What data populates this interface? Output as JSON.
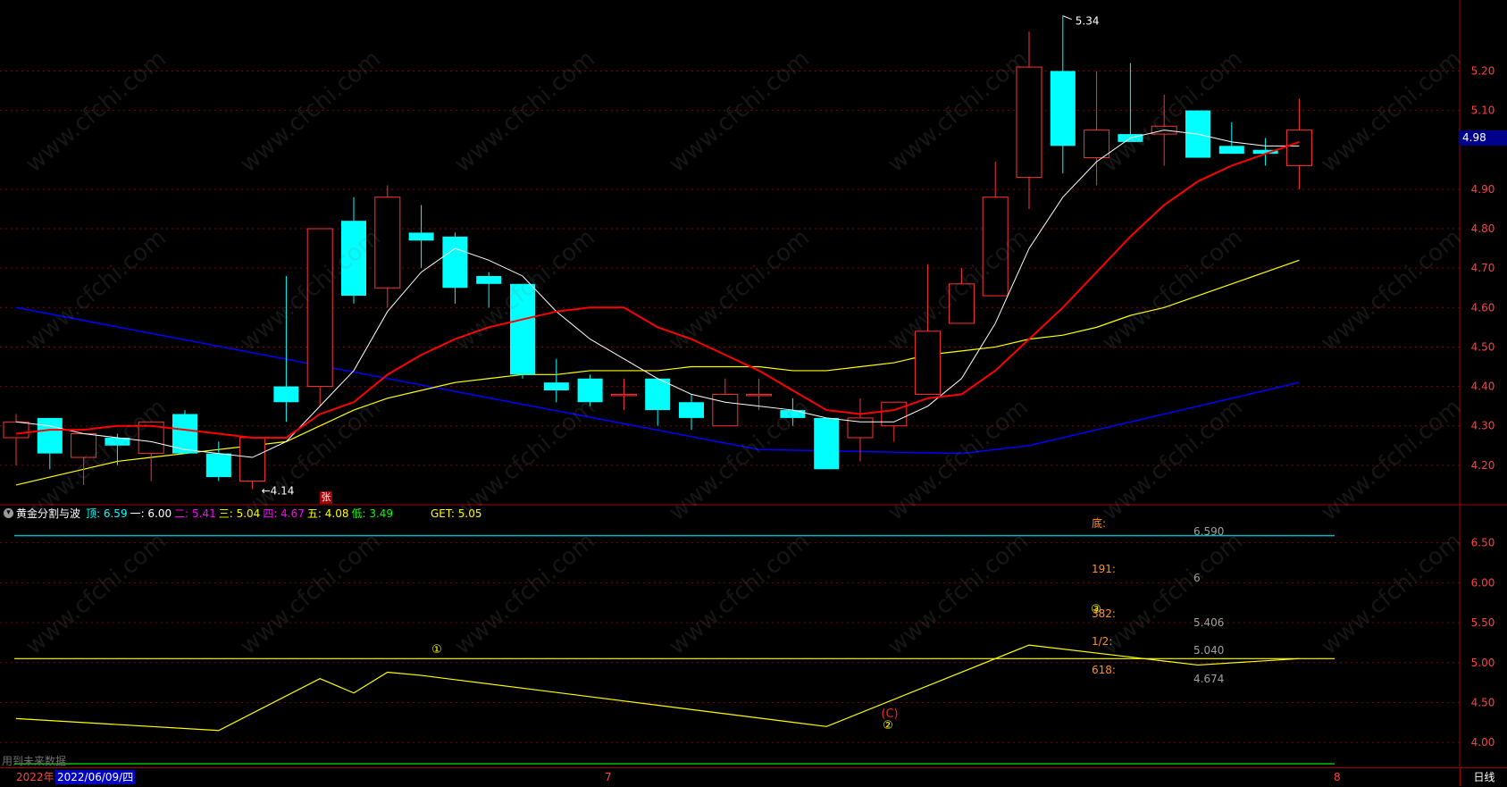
{
  "colors": {
    "up": "#ff3232",
    "down": "#00ffff",
    "ma_white": "#ffffff",
    "ma_red": "#ff0000",
    "ma_yellow": "#ffff00",
    "ma_blue": "#0000ff",
    "grid": "#800000",
    "axis_text": "#ff4040"
  },
  "top_panel": {
    "high_marker": "5.34",
    "low_marker": "←4.14",
    "zhang_badge": "张",
    "current_price_tag": "4.98",
    "y_ticks": [
      "5.20",
      "5.10",
      "4.90",
      "4.80",
      "4.70",
      "4.60",
      "4.50",
      "4.40",
      "4.30",
      "4.20"
    ]
  },
  "indicator": {
    "toggle_icon": "chevron-down-icon",
    "name": "黄金分割与波",
    "items": [
      {
        "label": "顶: 6.59",
        "color": "#00ffff"
      },
      {
        "label": "一: 6.00",
        "color": "#ffffff"
      },
      {
        "label": "二: 5.41",
        "color": "#ff00ff"
      },
      {
        "label": "三: 5.04",
        "color": "#ffff00"
      },
      {
        "label": "四: 4.67",
        "color": "#ff00ff"
      },
      {
        "label": "五: 4.08",
        "color": "#ffff00"
      },
      {
        "label": "低: 3.49",
        "color": "#00ff00"
      }
    ],
    "get_label": "GET: 5.05",
    "y_ticks": [
      "6.50",
      "6.00",
      "5.50",
      "5.00",
      "4.50",
      "4.00"
    ],
    "fib_labels": [
      "底:",
      "191:",
      "382:",
      "1/2:",
      "618:"
    ],
    "fib_values": [
      "6.590",
      "6",
      "5.406",
      "5.040",
      "4.674"
    ],
    "wave_marks": [
      "①",
      "②",
      "③",
      "(C)"
    ]
  },
  "footer": {
    "year": "2022年",
    "date": "2022/06/09/四",
    "month_7": "7",
    "month_8": "8",
    "period": "日线",
    "note": "用到未来数据"
  },
  "watermark": "www.cfchi.com",
  "chart_data": {
    "type": "candlestick",
    "y_range": [
      4.1,
      5.38
    ],
    "candles": [
      {
        "o": 4.27,
        "h": 4.33,
        "l": 4.2,
        "c": 4.31
      },
      {
        "o": 4.32,
        "h": 4.32,
        "l": 4.19,
        "c": 4.23
      },
      {
        "o": 4.22,
        "h": 4.26,
        "l": 4.15,
        "c": 4.28
      },
      {
        "o": 4.27,
        "h": 4.28,
        "l": 4.2,
        "c": 4.25
      },
      {
        "o": 4.23,
        "h": 4.27,
        "l": 4.16,
        "c": 4.31
      },
      {
        "o": 4.33,
        "h": 4.34,
        "l": 4.23,
        "c": 4.23
      },
      {
        "o": 4.23,
        "h": 4.26,
        "l": 4.16,
        "c": 4.17
      },
      {
        "o": 4.16,
        "h": 4.27,
        "l": 4.14,
        "c": 4.27
      },
      {
        "o": 4.4,
        "h": 4.68,
        "l": 4.31,
        "c": 4.36
      },
      {
        "o": 4.4,
        "h": 4.8,
        "l": 4.35,
        "c": 4.8
      },
      {
        "o": 4.82,
        "h": 4.88,
        "l": 4.61,
        "c": 4.63
      },
      {
        "o": 4.65,
        "h": 4.91,
        "l": 4.6,
        "c": 4.88
      },
      {
        "o": 4.79,
        "h": 4.86,
        "l": 4.7,
        "c": 4.77
      },
      {
        "o": 4.78,
        "h": 4.79,
        "l": 4.61,
        "c": 4.65
      },
      {
        "o": 4.68,
        "h": 4.69,
        "l": 4.6,
        "c": 4.66
      },
      {
        "o": 4.66,
        "h": 4.66,
        "l": 4.42,
        "c": 4.43
      },
      {
        "o": 4.41,
        "h": 4.47,
        "l": 4.36,
        "c": 4.39
      },
      {
        "o": 4.42,
        "h": 4.43,
        "l": 4.35,
        "c": 4.36
      },
      {
        "o": 4.38,
        "h": 4.42,
        "l": 4.34,
        "c": 4.38
      },
      {
        "o": 4.42,
        "h": 4.42,
        "l": 4.3,
        "c": 4.34
      },
      {
        "o": 4.36,
        "h": 4.38,
        "l": 4.29,
        "c": 4.32
      },
      {
        "o": 4.3,
        "h": 4.42,
        "l": 4.3,
        "c": 4.38
      },
      {
        "o": 4.38,
        "h": 4.42,
        "l": 4.34,
        "c": 4.38
      },
      {
        "o": 4.34,
        "h": 4.37,
        "l": 4.3,
        "c": 4.32
      },
      {
        "o": 4.32,
        "h": 4.32,
        "l": 4.19,
        "c": 4.19
      },
      {
        "o": 4.27,
        "h": 4.37,
        "l": 4.21,
        "c": 4.32
      },
      {
        "o": 4.3,
        "h": 4.36,
        "l": 4.26,
        "c": 4.36
      },
      {
        "o": 4.38,
        "h": 4.71,
        "l": 4.38,
        "c": 4.54
      },
      {
        "o": 4.56,
        "h": 4.7,
        "l": 4.56,
        "c": 4.66
      },
      {
        "o": 4.63,
        "h": 4.97,
        "l": 4.63,
        "c": 4.88
      },
      {
        "o": 4.93,
        "h": 5.3,
        "l": 4.85,
        "c": 5.21
      },
      {
        "o": 5.2,
        "h": 5.34,
        "l": 4.94,
        "c": 5.01
      },
      {
        "o": 4.98,
        "h": 5.2,
        "l": 4.91,
        "c": 5.05
      },
      {
        "o": 5.04,
        "h": 5.22,
        "l": 5.03,
        "c": 5.02
      },
      {
        "o": 5.04,
        "h": 5.14,
        "l": 4.96,
        "c": 5.06
      },
      {
        "o": 5.1,
        "h": 5.1,
        "l": 4.98,
        "c": 4.98
      },
      {
        "o": 5.01,
        "h": 5.07,
        "l": 4.99,
        "c": 4.99
      },
      {
        "o": 5.0,
        "h": 5.03,
        "l": 4.96,
        "c": 4.99
      },
      {
        "o": 4.96,
        "h": 5.13,
        "l": 4.9,
        "c": 5.05
      }
    ],
    "ma_white": [
      4.31,
      4.3,
      4.28,
      4.27,
      4.26,
      4.24,
      4.23,
      4.22,
      4.26,
      4.35,
      4.44,
      4.59,
      4.69,
      4.75,
      4.72,
      4.68,
      4.59,
      4.52,
      4.47,
      4.42,
      4.38,
      4.36,
      4.35,
      4.34,
      4.32,
      4.31,
      4.31,
      4.35,
      4.42,
      4.56,
      4.75,
      4.88,
      4.97,
      5.03,
      5.05,
      5.04,
      5.02,
      5.01,
      5.01
    ],
    "ma_red": [
      4.28,
      4.29,
      4.29,
      4.3,
      4.3,
      4.29,
      4.28,
      4.27,
      4.27,
      4.33,
      4.36,
      4.43,
      4.48,
      4.52,
      4.55,
      4.57,
      4.59,
      4.6,
      4.6,
      4.55,
      4.52,
      4.48,
      4.44,
      4.39,
      4.34,
      4.33,
      4.34,
      4.37,
      4.38,
      4.44,
      4.52,
      4.6,
      4.69,
      4.78,
      4.86,
      4.92,
      4.96,
      4.99,
      5.02
    ],
    "ma_yellow": [
      4.15,
      4.17,
      4.19,
      4.21,
      4.22,
      4.23,
      4.24,
      4.25,
      4.26,
      4.3,
      4.34,
      4.37,
      4.39,
      4.41,
      4.42,
      4.43,
      4.43,
      4.44,
      4.44,
      4.44,
      4.45,
      4.45,
      4.45,
      4.44,
      4.44,
      4.45,
      4.46,
      4.48,
      4.49,
      4.5,
      4.52,
      4.53,
      4.55,
      4.58,
      4.6,
      4.63,
      4.66,
      4.69,
      4.72
    ],
    "ma_blue_points": [
      [
        0,
        4.6
      ],
      [
        22,
        4.24
      ],
      [
        28,
        4.23
      ],
      [
        30,
        4.25
      ],
      [
        38,
        4.41
      ]
    ],
    "wave_y_range": [
      3.7,
      6.72
    ],
    "wave_line": [
      [
        0,
        4.3
      ],
      [
        6,
        4.15
      ],
      [
        9,
        4.8
      ],
      [
        10,
        4.62
      ],
      [
        11,
        4.88
      ],
      [
        12,
        4.84
      ],
      [
        24,
        4.2
      ],
      [
        30,
        5.22
      ],
      [
        34,
        5.02
      ],
      [
        35,
        4.97
      ],
      [
        38,
        5.05
      ]
    ],
    "wave_get": 5.05,
    "wave_top": 6.59
  }
}
